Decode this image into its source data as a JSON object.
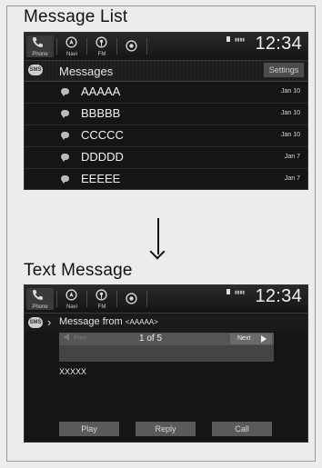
{
  "list_view": {
    "section_title": "Message List",
    "statusbar": {
      "buttons": [
        {
          "label": "Phone",
          "icon": "phone-icon"
        },
        {
          "label": "Navi",
          "icon": "navi-icon"
        },
        {
          "label": "FM",
          "icon": "fm-radio-icon"
        },
        {
          "label": "",
          "icon": "audio-source-icon"
        }
      ],
      "clock": "12:34"
    },
    "header": {
      "badge": "SMS",
      "title": "Messages",
      "settings_label": "Settings"
    },
    "messages": [
      {
        "name": "AAAAA",
        "date": "Jan 10"
      },
      {
        "name": "BBBBB",
        "date": "Jan 10"
      },
      {
        "name": "CCCCC",
        "date": "Jan 10"
      },
      {
        "name": "DDDDD",
        "date": "Jan 7"
      },
      {
        "name": "EEEEE",
        "date": "Jan 7"
      }
    ]
  },
  "text_view": {
    "section_title": "Text Message",
    "statusbar": {
      "buttons": [
        {
          "label": "Phone",
          "icon": "phone-icon"
        },
        {
          "label": "Navi",
          "icon": "navi-icon"
        },
        {
          "label": "FM",
          "icon": "fm-radio-icon"
        },
        {
          "label": "",
          "icon": "audio-source-icon"
        }
      ],
      "clock": "12:34"
    },
    "header": {
      "badge": "SMS",
      "from_prefix": "Message from",
      "from_name": "<AAAAA>"
    },
    "pager": {
      "prev_label": "Prev",
      "count": "1 of 5",
      "next_label": "Next"
    },
    "body": "XXXXX",
    "actions": {
      "play": "Play",
      "reply": "Reply",
      "call": "Call"
    }
  },
  "colors": {
    "screen_bg": "#151515",
    "button_bg": "#5a5a5a",
    "page_bg": "#ececec"
  }
}
